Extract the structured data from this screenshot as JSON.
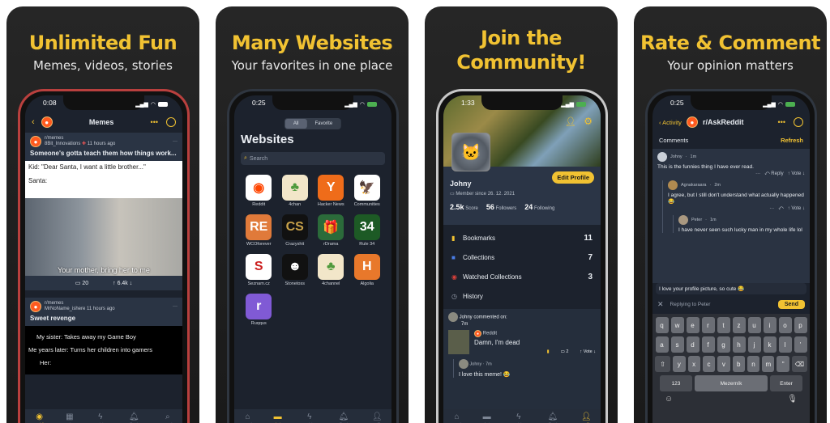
{
  "panels": [
    {
      "headline": "Unlimited Fun",
      "subtitle": "Memes, videos, stories",
      "phone": {
        "time": "0:08",
        "nav_title": "Memes",
        "posts": [
          {
            "subreddit": "r/memes",
            "author": "8Bit_Innovations",
            "time": "11 hours ago",
            "title": "Someone's gotta teach them how things work...",
            "meme_top": "Kid: \"Dear Santa, I want a little brother...\"",
            "meme_mid": "Santa:",
            "meme_caption": "Your mother, bring her to me",
            "comments": "20",
            "votes": "6.4k"
          },
          {
            "subreddit": "r/memes",
            "author": "MrNoName_ishere",
            "time": "11 hours ago",
            "title": "Sweet revenge",
            "lines": [
              "My sister: Takes away my Game Boy",
              "Me years later: Turns her children into gamers",
              "Her:"
            ]
          }
        ],
        "tabs": [
          {
            "label": "Reddit",
            "icon": "reddit-icon",
            "active": true
          },
          {
            "label": "Sections",
            "icon": "sections-icon"
          },
          {
            "label": "Activity",
            "icon": "bolt-icon"
          },
          {
            "label": "Notifications",
            "icon": "bell-icon"
          },
          {
            "label": "Search",
            "icon": "search-icon"
          }
        ]
      }
    },
    {
      "headline": "Many Websites",
      "subtitle": "Your favorites in one place",
      "phone": {
        "time": "0:25",
        "segments": [
          "All",
          "Favorite"
        ],
        "selected_segment": "All",
        "title": "Websites",
        "search_placeholder": "Search",
        "sites": [
          {
            "name": "Reddit",
            "glyph": "◉",
            "bg": "#ffffff",
            "fg": "#ff4500"
          },
          {
            "name": "4chan",
            "glyph": "♣",
            "bg": "#f2e6c9",
            "fg": "#4f9a3c"
          },
          {
            "name": "Hacker News",
            "glyph": "Y",
            "bg": "#ef6c1a",
            "fg": "#ffffff"
          },
          {
            "name": "Communities",
            "glyph": "🦅",
            "bg": "#ffffff",
            "fg": "#222222"
          },
          {
            "name": "WCOforever",
            "glyph": "RE",
            "bg": "#e07a3a",
            "fg": "#ffffff"
          },
          {
            "name": "Crazyshit",
            "glyph": "CS",
            "bg": "#111111",
            "fg": "#c9a24a"
          },
          {
            "name": "rDrama",
            "glyph": "🎁",
            "bg": "#2b6b3a",
            "fg": "#ffffff"
          },
          {
            "name": "Rule 34",
            "glyph": "34",
            "bg": "#1d5a25",
            "fg": "#ffffff"
          },
          {
            "name": "Seznam.cz",
            "glyph": "S",
            "bg": "#ffffff",
            "fg": "#cc1f1f"
          },
          {
            "name": "Stonetoss",
            "glyph": "☻",
            "bg": "#111111",
            "fg": "#ffffff"
          },
          {
            "name": "4channel",
            "glyph": "♣",
            "bg": "#f2e6c9",
            "fg": "#4f9a3c"
          },
          {
            "name": "Algolia",
            "glyph": "H",
            "bg": "#e8782b",
            "fg": "#ffffff"
          },
          {
            "name": "Ruqqus",
            "glyph": "r",
            "bg": "#805ad5",
            "fg": "#ffffff"
          }
        ],
        "tabs": [
          {
            "label": "Feed",
            "icon": "home-icon"
          },
          {
            "label": "Websites",
            "icon": "websites-icon",
            "active": true
          },
          {
            "label": "Activity",
            "icon": "bolt-icon"
          },
          {
            "label": "Notifications",
            "icon": "bell-icon"
          },
          {
            "label": "Profile",
            "icon": "person-icon"
          }
        ]
      }
    },
    {
      "headline_line1": "Join the",
      "headline_line2": "Community!",
      "phone": {
        "time": "1:33",
        "name": "Johny",
        "edit_label": "Edit Profile",
        "member_since": "Member since 26. 12. 2021",
        "stats": [
          {
            "value": "2.5k",
            "label": "Score"
          },
          {
            "value": "56",
            "label": "Followers"
          },
          {
            "value": "24",
            "label": "Following"
          }
        ],
        "menu": [
          {
            "label": "Bookmarks",
            "count": "11",
            "icon": "bookmark-icon",
            "color": "#f1c232"
          },
          {
            "label": "Collections",
            "count": "7",
            "icon": "collections-icon",
            "color": "#4a7ee8"
          },
          {
            "label": "Watched Collections",
            "count": "3",
            "icon": "eye-icon",
            "color": "#d9403a"
          },
          {
            "label": "History",
            "count": "",
            "icon": "history-icon",
            "color": "#9aa2b0"
          }
        ],
        "activity": {
          "header": "Johny commented on:",
          "header_time": "7m",
          "source": "Reddit",
          "post_title": "Damn, I'm dead",
          "comment_count": "2",
          "vote_label": "Vote",
          "reply_author": "Johny",
          "reply_time": "7m",
          "reply_text": "I love this meme! 😂"
        },
        "tabs": [
          {
            "label": "Feed",
            "icon": "home-icon"
          },
          {
            "label": "Websites",
            "icon": "websites-icon"
          },
          {
            "label": "Activity",
            "icon": "bolt-icon"
          },
          {
            "label": "Notifications",
            "icon": "bell-icon"
          },
          {
            "label": "Profile",
            "icon": "person-icon",
            "active": true
          }
        ]
      }
    },
    {
      "headline": "Rate & Comment",
      "subtitle": "Your opinion matters",
      "phone": {
        "time": "0:25",
        "back_label": "Activity",
        "nav_title": "r/AskReddit",
        "comments_label": "Comments",
        "refresh_label": "Refresh",
        "comments": [
          {
            "author": "Johny",
            "time": "1m",
            "text": "This is the funnies thing I have ever read.",
            "reply": "Reply",
            "vote": "Vote"
          },
          {
            "author": "Agnakaraara",
            "time": "2m",
            "text": "I agree, but I still don't understand what actually happened 😂",
            "vote": "Vote"
          },
          {
            "author": "Peter",
            "time": "1m",
            "text": "I have never seen such lucky man in my whole life lol"
          }
        ],
        "input_value": "I love your profile picture, so cute 😂",
        "replying_to": "Replying to Peter",
        "send_label": "Send",
        "keyboard": {
          "row1": [
            "q",
            "w",
            "e",
            "r",
            "t",
            "z",
            "u",
            "i",
            "o",
            "p"
          ],
          "row2": [
            "a",
            "s",
            "d",
            "f",
            "g",
            "h",
            "j",
            "k",
            "l",
            "'"
          ],
          "row3": [
            "y",
            "x",
            "c",
            "v",
            "b",
            "n",
            "m",
            "\""
          ],
          "numbers": "123",
          "space": "Mezerník",
          "enter": "Enter"
        }
      }
    }
  ]
}
